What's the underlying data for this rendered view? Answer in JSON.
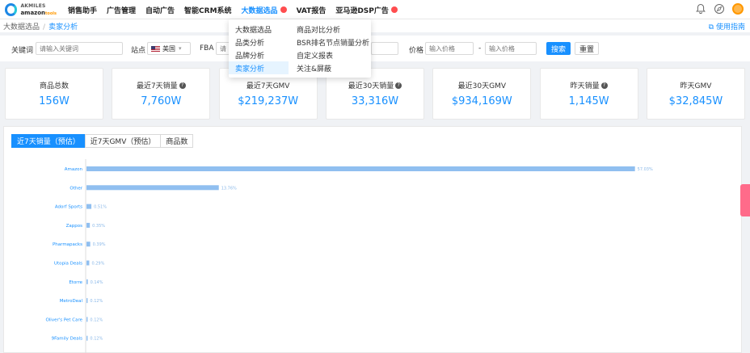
{
  "logo": {
    "line1": "AKMILES",
    "line2": "amazon",
    "line3": "tools"
  },
  "nav": [
    {
      "label": "销售助手"
    },
    {
      "label": "广告管理"
    },
    {
      "label": "自动广告"
    },
    {
      "label": "智能CRM系统"
    },
    {
      "label": "大数据选品"
    },
    {
      "label": "VAT报告"
    },
    {
      "label": "亚马逊DSP广告"
    }
  ],
  "breadcrumb": {
    "parent": "大数据选品",
    "current": "卖家分析"
  },
  "help_link": "使用指南",
  "filters": {
    "keyword_label": "关键词",
    "keyword_placeholder": "请输入关键词",
    "site_label": "站点",
    "site_value": "美国",
    "fba_label": "FBA",
    "fba_placeholder": "请",
    "price_label": "价格",
    "price_min_placeholder": "输入价格",
    "price_sep": "-",
    "price_max_placeholder": "输入价格",
    "search_btn": "搜索",
    "reset_btn": "重置"
  },
  "dropdown": {
    "left": [
      "大数据选品",
      "品类分析",
      "品牌分析",
      "卖家分析"
    ],
    "right": [
      "商品对比分析",
      "BSR排名节点销量分析",
      "自定义报表",
      "关注&屏蔽"
    ]
  },
  "stats": [
    {
      "label": "商品总数",
      "value": "156W",
      "info": false
    },
    {
      "label": "最近7天销量",
      "value": "7,760W",
      "info": true
    },
    {
      "label": "最近7天GMV",
      "value": "$219,237W",
      "info": false
    },
    {
      "label": "最近30天销量",
      "value": "33,316W",
      "info": true
    },
    {
      "label": "最近30天GMV",
      "value": "$934,169W",
      "info": false
    },
    {
      "label": "昨天销量",
      "value": "1,145W",
      "info": true
    },
    {
      "label": "昨天GMV",
      "value": "$32,845W",
      "info": false
    }
  ],
  "tabs": [
    "近7天销量（预估）",
    "近7天GMV（预估）",
    "商品数"
  ],
  "chart_data": {
    "type": "bar",
    "orientation": "horizontal",
    "categories": [
      "Amazon",
      "Other",
      "Adorf Sports",
      "Zappos",
      "Pharmapacks",
      "Utopia Deals",
      "Etorre",
      "MetroDeal",
      "Oliver's Pet Care",
      "9Family Deals"
    ],
    "values": [
      57.03,
      13.76,
      0.51,
      0.35,
      0.39,
      0.29,
      0.14,
      0.12,
      0.12,
      0.12
    ],
    "data_labels": [
      "57.03%",
      "13.76%",
      "0.51%",
      "0.35%",
      "0.39%",
      "0.29%",
      "0.14%",
      "0.12%",
      "0.12%",
      "0.12%"
    ],
    "xlim": [
      0,
      60
    ],
    "bar_color": "#90bff0"
  }
}
